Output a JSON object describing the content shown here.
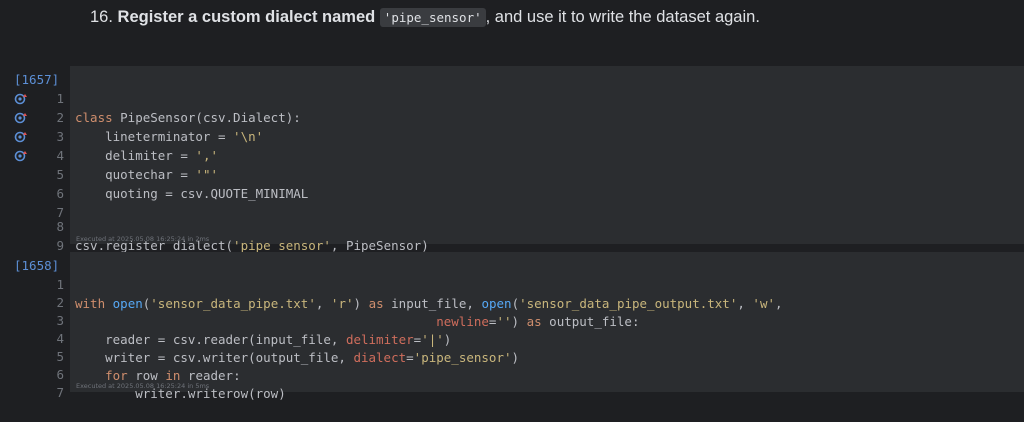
{
  "markdown": {
    "number": "16.",
    "bold_text": "Register a custom dialect named",
    "code_text": "'pipe_sensor'",
    "rest_text": ", and use it to write the dataset again."
  },
  "cells": [
    {
      "execution_count": "[1657]",
      "footer": "Executed at 2025.05.08 16:25:24 in 2ms",
      "lines": [
        {
          "n": "1",
          "icon": false
        },
        {
          "n": "2",
          "icon": true
        },
        {
          "n": "3",
          "icon": true
        },
        {
          "n": "4",
          "icon": true
        },
        {
          "n": "5",
          "icon": true
        },
        {
          "n": "6",
          "icon": false
        },
        {
          "n": "7",
          "icon": false
        },
        {
          "n": "8",
          "icon": false
        },
        {
          "n": "9",
          "icon": false
        }
      ],
      "code": {
        "l1": {
          "a": "class ",
          "b": "PipeSensor(csv.Dialect):"
        },
        "l2": {
          "a": "    lineterminator = ",
          "b": "'\\n'"
        },
        "l3": {
          "a": "    delimiter = ",
          "b": "','"
        },
        "l4": {
          "a": "    quotechar = ",
          "b": "'\"'"
        },
        "l5": {
          "a": "    quoting = csv.QUOTE_MINIMAL"
        },
        "l8": {
          "a": "csv.register_dialect(",
          "b": "'pipe_sensor'",
          "c": ", PipeSensor)"
        }
      }
    },
    {
      "execution_count": "[1658]",
      "footer": "Executed at 2025.05.08 16:25:24 in 5ms",
      "lines": [
        {
          "n": "1"
        },
        {
          "n": "2"
        },
        {
          "n": "3"
        },
        {
          "n": "4"
        },
        {
          "n": "5"
        },
        {
          "n": "6"
        },
        {
          "n": "7"
        }
      ],
      "code": {
        "l1": {
          "kw1": "with ",
          "fn1": "open",
          "p1": "(",
          "s1": "'sensor_data_pipe.txt'",
          "p2": ", ",
          "s2": "'r'",
          "p3": ") ",
          "kw2": "as",
          "p4": " input_file, ",
          "fn2": "open",
          "p5": "(",
          "s3": "'sensor_data_pipe_output.txt'",
          "p6": ", ",
          "s4": "'w'",
          "p7": ","
        },
        "l2": {
          "pad": "                                                ",
          "param": "newline",
          "eq": "=",
          "s": "''",
          "rest": ") ",
          "kw": "as",
          "end": " output_file:"
        },
        "l3": {
          "a": "    reader = csv.reader(input_file, ",
          "param": "delimiter",
          "eq": "=",
          "s": "'|'",
          "end": ")"
        },
        "l4": {
          "a": "    writer = csv.writer(output_file, ",
          "param": "dialect",
          "eq": "=",
          "s": "'pipe_sensor'",
          "end": ")"
        },
        "l5": {
          "kw1": "    for ",
          "a": "row ",
          "kw2": "in",
          "b": " reader:"
        },
        "l6": {
          "a": "        writer.writerow(row)"
        }
      }
    }
  ],
  "icon": "override-method-icon"
}
